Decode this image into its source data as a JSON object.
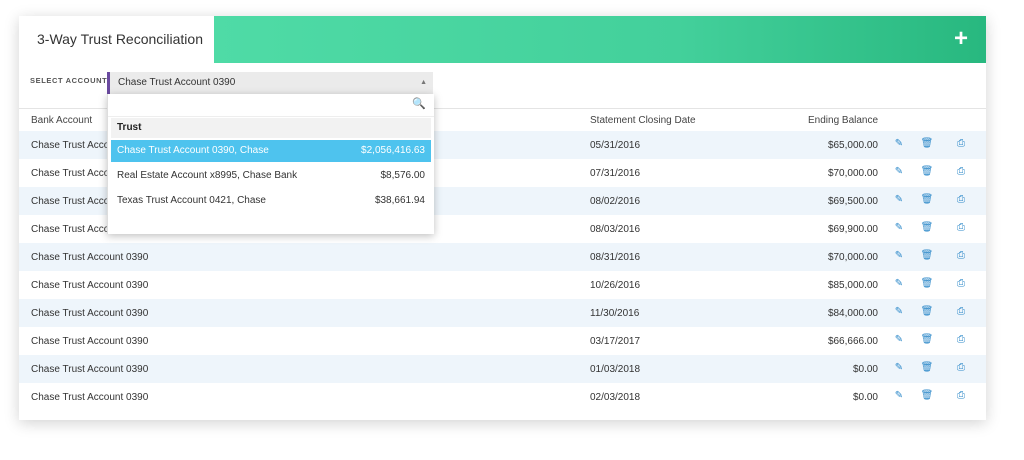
{
  "header": {
    "tab_title": "3-Way Trust Reconciliation",
    "add_label": "+"
  },
  "select": {
    "label": "SELECT ACCOUNT",
    "value": "Chase Trust Account 0390",
    "arrow": "▲"
  },
  "dropdown": {
    "search_icon": "🔍",
    "group": "Trust",
    "options": [
      {
        "name": "Chase Trust Account 0390, Chase",
        "amount": "$2,056,416.63",
        "selected": true
      },
      {
        "name": "Real Estate Account x8995, Chase Bank",
        "amount": "$8,576.00",
        "selected": false
      },
      {
        "name": "Texas Trust Account 0421, Chase",
        "amount": "$38,661.94",
        "selected": false
      }
    ]
  },
  "table": {
    "headers": {
      "bank": "Bank Account",
      "date": "Statement Closing Date",
      "balance": "Ending Balance"
    },
    "rows": [
      {
        "bank": "Chase Trust Acco",
        "date": "05/31/2016",
        "balance": "$65,000.00"
      },
      {
        "bank": "Chase Trust Acco",
        "date": "07/31/2016",
        "balance": "$70,000.00"
      },
      {
        "bank": "Chase Trust Acco",
        "date": "08/02/2016",
        "balance": "$69,500.00"
      },
      {
        "bank": "Chase Trust Account 0390",
        "date": "08/03/2016",
        "balance": "$69,900.00"
      },
      {
        "bank": "Chase Trust Account 0390",
        "date": "08/31/2016",
        "balance": "$70,000.00"
      },
      {
        "bank": "Chase Trust Account 0390",
        "date": "10/26/2016",
        "balance": "$85,000.00"
      },
      {
        "bank": "Chase Trust Account 0390",
        "date": "11/30/2016",
        "balance": "$84,000.00"
      },
      {
        "bank": "Chase Trust Account 0390",
        "date": "03/17/2017",
        "balance": "$66,666.00"
      },
      {
        "bank": "Chase Trust Account 0390",
        "date": "01/03/2018",
        "balance": "$0.00"
      },
      {
        "bank": "Chase Trust Account 0390",
        "date": "02/03/2018",
        "balance": "$0.00"
      }
    ],
    "icons": {
      "edit": "✎",
      "delete": "🗑",
      "print": "⎙"
    }
  },
  "colors": {
    "accent": "#43d09b",
    "selection": "#4ec3ee",
    "row_alt": "#eef5fb",
    "icon": "#2a87c8"
  }
}
